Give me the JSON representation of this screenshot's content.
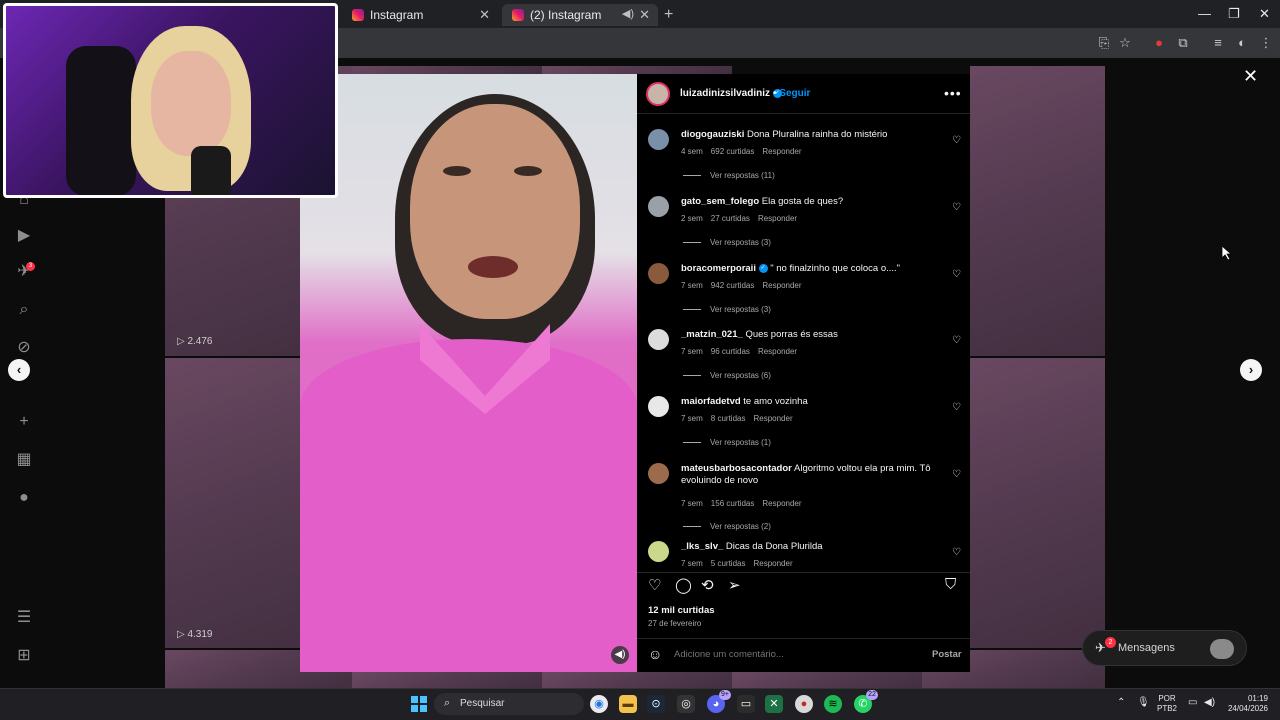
{
  "browser": {
    "tabs": [
      {
        "title": "Instagram"
      },
      {
        "title": "(2) Instagram"
      }
    ],
    "new_tab": "+",
    "window_controls": {
      "minimize": "—",
      "maximize": "❐",
      "close": "✕"
    }
  },
  "post": {
    "username": "luizadinizsilvadiniz",
    "verified": true,
    "follow_label": "Seguir",
    "more": "•••",
    "likes": "12 mil curtidas",
    "date": "27 de fevereiro",
    "add_comment_placeholder": "Adicione um comentário...",
    "post_label": "Postar"
  },
  "comments": [
    {
      "user": "diogogauziski",
      "text": "Dona Pluralina rainha do mistério",
      "time": "4 sem",
      "likes": "692 curtidas",
      "reply": "Responder",
      "replies": "Ver respostas (11)",
      "avatar_color": "#7a8fa8"
    },
    {
      "user": "gato_sem_folego",
      "text": "Ela gosta de ques?",
      "time": "2 sem",
      "likes": "27 curtidas",
      "reply": "Responder",
      "replies": "Ver respostas (3)",
      "avatar_color": "#9aa0a8"
    },
    {
      "user": "boracomerporaii",
      "verified": true,
      "text": "\" no finalzinho que coloca o....\"",
      "time": "7 sem",
      "likes": "942 curtidas",
      "reply": "Responder",
      "replies": "Ver respostas (3)",
      "avatar_color": "#8a5a3c"
    },
    {
      "user": "_matzin_021_",
      "text": "Ques porras és essas",
      "time": "7 sem",
      "likes": "96 curtidas",
      "reply": "Responder",
      "replies": "Ver respostas (6)",
      "avatar_color": "#dcdcdc"
    },
    {
      "user": "maiorfadetvd",
      "text": "te amo vozinha",
      "time": "7 sem",
      "likes": "8 curtidas",
      "reply": "Responder",
      "replies": "Ver respostas (1)",
      "avatar_color": "#e8e8e8"
    },
    {
      "user": "mateusbarbosacontador",
      "text": "Algoritmo voltou ela pra mim. Tô evoluindo de novo",
      "time": "7 sem",
      "likes": "156 curtidas",
      "reply": "Responder",
      "replies": "Ver respostas (2)",
      "avatar_color": "#9c6b4e"
    },
    {
      "user": "_lks_slv_",
      "text": "Dicas da Dona Plurilda",
      "time": "7 sem",
      "likes": "5 curtidas",
      "reply": "Responder",
      "replies": "",
      "avatar_color": "#c9d88a"
    }
  ],
  "grid": {
    "views": [
      "2.476",
      "4.319"
    ]
  },
  "messages": {
    "label": "Mensagens",
    "badge": "2"
  },
  "nav_badges": {
    "notifications": "3"
  },
  "taskbar": {
    "search_label": "Pesquisar",
    "badges": {
      "discord": "9+",
      "whatsapp": "22"
    },
    "lang_line1": "POR",
    "lang_line2": "PTB2",
    "time": "01:19",
    "date": "24/04/2026"
  },
  "colors": {
    "accent_blue": "#0095f6",
    "badge_red": "#ff3040",
    "shirt_pink": "#e45ec9",
    "webcam_purple": "#6d27b5"
  }
}
